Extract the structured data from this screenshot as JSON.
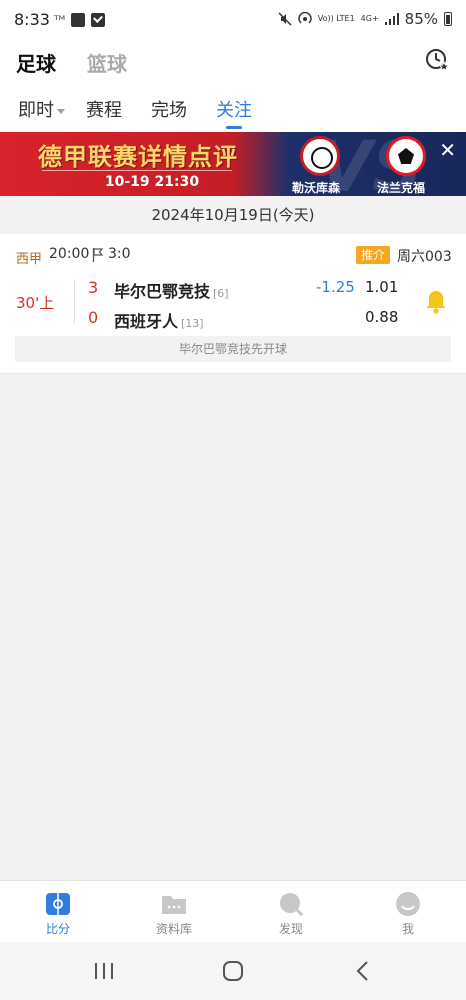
{
  "status_bar": {
    "time": "8:33",
    "left_icons": [
      "carrier-icon",
      "gallery-icon",
      "checkbox-icon"
    ],
    "right_icons": [
      "mute-icon",
      "hotspot-icon",
      "volte-icon",
      "4g-icon",
      "signal-icon"
    ],
    "volte_label": "Vo)) LTE1",
    "network_label": "4G+",
    "battery": "85%"
  },
  "header": {
    "sport_tabs": [
      {
        "label": "足球",
        "active": true
      },
      {
        "label": "篮球",
        "active": false
      }
    ],
    "history_icon": "clock-star-icon"
  },
  "sub_tabs": [
    {
      "label": "即时",
      "has_dropdown": true,
      "active": false
    },
    {
      "label": "赛程",
      "active": false
    },
    {
      "label": "完场",
      "active": false
    },
    {
      "label": "关注",
      "active": true
    }
  ],
  "banner": {
    "title": "德甲联赛详情点评",
    "datetime": "10-19 21:30",
    "home_team": "勒沃库森",
    "away_team": "法兰克福",
    "vs_text": "VS",
    "close_icon": "close-icon"
  },
  "date_header": "2024年10月19日(今天)",
  "match": {
    "league": "西甲",
    "kickoff": "20:00",
    "halftime_score": "3:0",
    "recommend_badge": "推介",
    "match_code": "周六003",
    "minute": "30'上",
    "home": {
      "score": "3",
      "name": "毕尔巴鄂竞技",
      "rank": "[6]"
    },
    "away": {
      "score": "0",
      "name": "西班牙人",
      "rank": "[13]"
    },
    "handicap": "-1.25",
    "odds_home": "1.01",
    "odds_away": "0.88",
    "event_text": "毕尔巴鄂竞技先开球",
    "accent_colors": {
      "live_red": "#d93025",
      "blue": "#2f7de1",
      "bell_yellow": "#f5c518",
      "badge_orange": "#f5a623"
    }
  },
  "bottom_nav": [
    {
      "label": "比分",
      "icon": "scoreboard-icon",
      "active": true
    },
    {
      "label": "资料库",
      "icon": "folder-icon",
      "active": false
    },
    {
      "label": "发现",
      "icon": "discover-icon",
      "active": false
    },
    {
      "label": "我",
      "icon": "profile-icon",
      "active": false
    }
  ],
  "system_nav": [
    "recents-icon",
    "home-icon",
    "back-icon"
  ]
}
